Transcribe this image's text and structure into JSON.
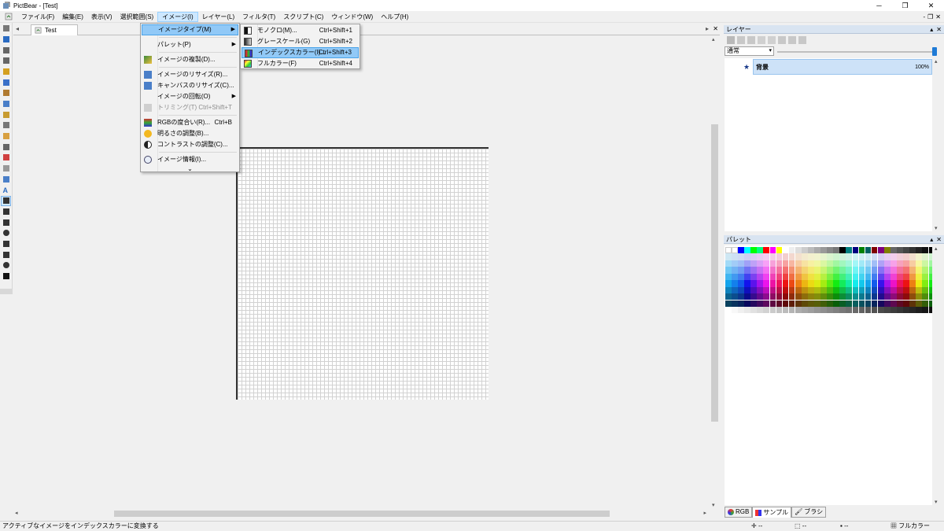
{
  "window": {
    "title": "PictBear - [Test]",
    "controls": {
      "minimize": "─",
      "restore": "❐",
      "close": "✕"
    }
  },
  "menubar": {
    "items": [
      "ファイル(F)",
      "編集(E)",
      "表示(V)",
      "選択範囲(S)",
      "イメージ(I)",
      "レイヤー(L)",
      "フィルタ(T)",
      "スクリプト(C)",
      "ウィンドウ(W)",
      "ヘルプ(H)"
    ],
    "active_index": 4,
    "mdi_controls": {
      "minimize": "-",
      "restore": "❐",
      "close": "✕"
    }
  },
  "document": {
    "tab_label": "Test",
    "nav_prev": "◂",
    "nav_next": "▸",
    "close": "✕"
  },
  "image_menu": {
    "items": [
      {
        "label": "イメージタイプ(M)",
        "submenu": true,
        "highlighted": true
      },
      {
        "label": "パレット(P)",
        "submenu": true
      },
      {
        "label": "イメージの複製(D)..."
      },
      {
        "label": "イメージのリサイズ(R)..."
      },
      {
        "label": "キャンバスのリサイズ(C)..."
      },
      {
        "label": "イメージの回転(O)",
        "submenu": true
      },
      {
        "label": "トリミング(T)",
        "shortcut": "Ctrl+Shift+T",
        "disabled": true
      },
      {
        "label": "RGBの度合い(R)...",
        "shortcut": "Ctrl+B"
      },
      {
        "label": "明るさの調整(B)..."
      },
      {
        "label": "コントラストの調整(C)..."
      },
      {
        "label": "イメージ情報(I)..."
      }
    ],
    "more": "⌄"
  },
  "image_type_submenu": {
    "items": [
      {
        "label": "モノクロ(M)...",
        "shortcut": "Ctrl+Shift+1"
      },
      {
        "label": "グレースケール(G)",
        "shortcut": "Ctrl+Shift+2"
      },
      {
        "label": "インデックスカラー(I)...",
        "shortcut": "Ctrl+Shift+3",
        "highlighted": true
      },
      {
        "label": "フルカラー(F)",
        "shortcut": "Ctrl+Shift+4"
      }
    ]
  },
  "layers_panel": {
    "title": "レイヤー",
    "blend_mode": "通常",
    "opacity_percent": 100,
    "layers": [
      {
        "name": "背景",
        "opacity": "100%",
        "visible_mark": "★"
      }
    ]
  },
  "palette_panel": {
    "title": "パレット",
    "tabs": [
      "RGB",
      "サンプル",
      "ブラシ"
    ],
    "active_tab": 1
  },
  "status_bar": {
    "message": "アクティブなイメージをインデックスカラーに変換する",
    "field_1": "--",
    "field_2": "--",
    "field_3": "--",
    "color_mode": "フルカラー"
  },
  "colors": {
    "menu_highlight": "#91c9f7",
    "panel_title": "#d9e4f1",
    "selected_layer": "#cde2f8",
    "slider_knob": "#1e7ad6"
  },
  "tools": [
    "hand-icon",
    "zoom-icon",
    "move-icon",
    "rect-select-icon",
    "lasso-icon",
    "pen-icon",
    "brush-icon",
    "airbrush-icon",
    "pencil-icon",
    "smudge-icon",
    "marker-icon",
    "dropper-icon",
    "eraser-icon",
    "gradient-icon",
    "fill-icon",
    "text-icon",
    "line-icon",
    "curve-icon",
    "rectangle-icon",
    "ellipse-icon",
    "freeform-icon",
    "filled-rect-icon",
    "filled-ellipse-icon",
    "filled-freeform-icon"
  ]
}
